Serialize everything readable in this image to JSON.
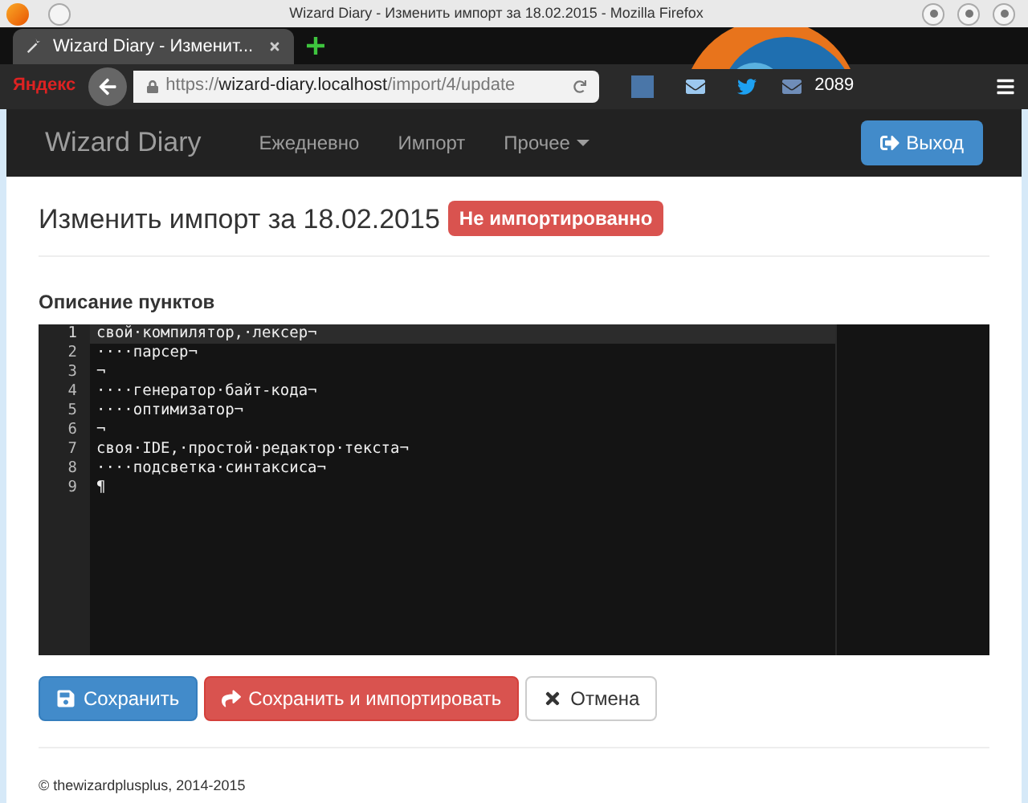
{
  "window": {
    "title": "Wizard Diary - Изменить импорт за 18.02.2015 - Mozilla Firefox"
  },
  "browser": {
    "tab": "Wizard Diary - Изменит...",
    "search_logo": "Яндекс",
    "url_scheme": "https://",
    "url_host": "wizard-diary.localhost",
    "url_path": "/import/4/update",
    "counter": "2089"
  },
  "navbar": {
    "brand": "Wizard Diary",
    "items": [
      {
        "label": "Ежедневно",
        "kind": "link"
      },
      {
        "label": "Импорт",
        "kind": "link"
      },
      {
        "label": "Прочее",
        "kind": "dropdown"
      }
    ],
    "logout": "Выход"
  },
  "page": {
    "title": "Изменить импорт за 18.02.2015",
    "status": "Не импортированно",
    "field_label": "Описание пунктов"
  },
  "editor": {
    "lines": [
      {
        "number": "1",
        "text": "свой·компилятор,·лексер¬",
        "active": true
      },
      {
        "number": "2",
        "text": "····парсер¬",
        "active": false
      },
      {
        "number": "3",
        "text": "¬",
        "active": false
      },
      {
        "number": "4",
        "text": "····генератор·байт-кода¬",
        "active": false
      },
      {
        "number": "5",
        "text": "····оптимизатор¬",
        "active": false
      },
      {
        "number": "6",
        "text": "¬",
        "active": false
      },
      {
        "number": "7",
        "text": "своя·IDE,·простой·редактор·текста¬",
        "active": false
      },
      {
        "number": "8",
        "text": "····подсветка·синтаксиса¬",
        "active": false
      },
      {
        "number": "9",
        "text": "¶",
        "active": false
      }
    ]
  },
  "buttons": [
    {
      "label": "Сохранить",
      "kind": "save"
    },
    {
      "label": "Сохранить и импортировать",
      "kind": "import"
    },
    {
      "label": "Отмена",
      "kind": "cancel"
    }
  ],
  "footer": "© thewizardplusplus, 2014-2015"
}
